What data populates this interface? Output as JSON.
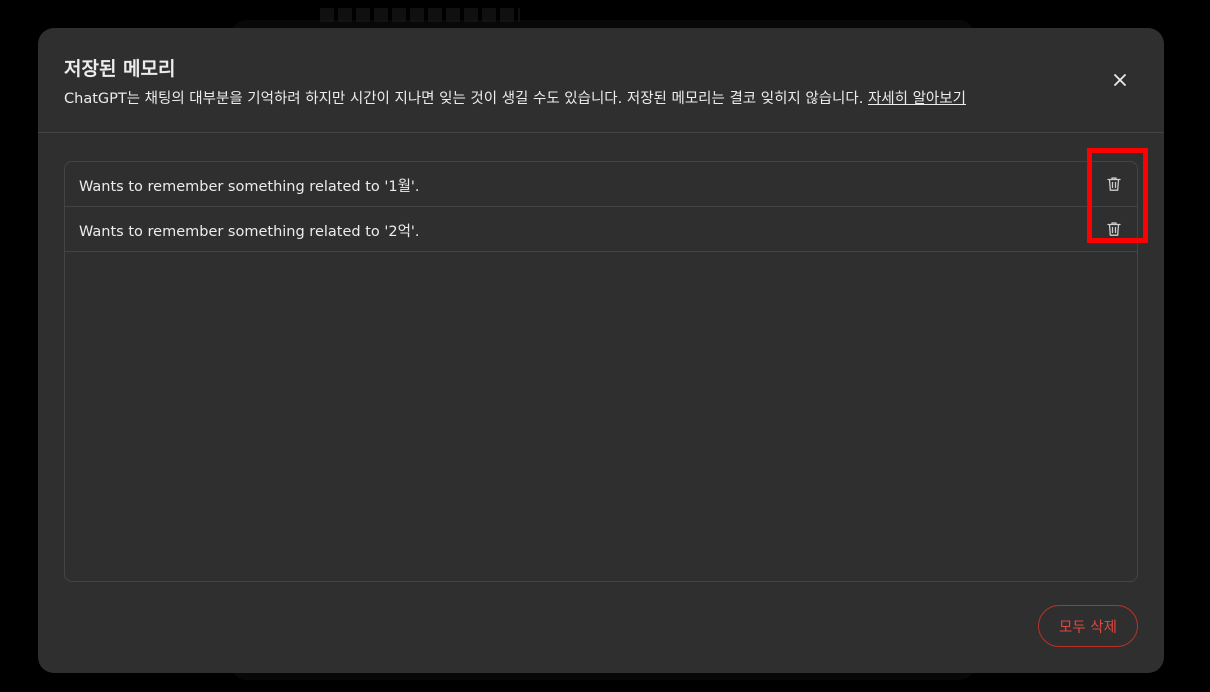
{
  "modal": {
    "title": "저장된 메모리",
    "description": "ChatGPT는 채팅의 대부분을 기억하려 하지만 시간이 지나면 잊는 것이 생길 수도 있습니다. 저장된 메모리는 결코 잊히지 않습니다.",
    "learn_more": "자세히 알아보기",
    "close_icon": "close-icon"
  },
  "memories": [
    {
      "text": "Wants to remember something related to '1월'.",
      "icon": "trash-icon"
    },
    {
      "text": "Wants to remember something related to '2억'.",
      "icon": "trash-icon"
    }
  ],
  "footer": {
    "delete_all_label": "모두 삭제"
  },
  "colors": {
    "backdrop": "#000000",
    "modal_bg": "#2f2f2f",
    "border": "#444444",
    "text": "#ececec",
    "danger": "#e0473d",
    "annotation": "#ff0000"
  }
}
